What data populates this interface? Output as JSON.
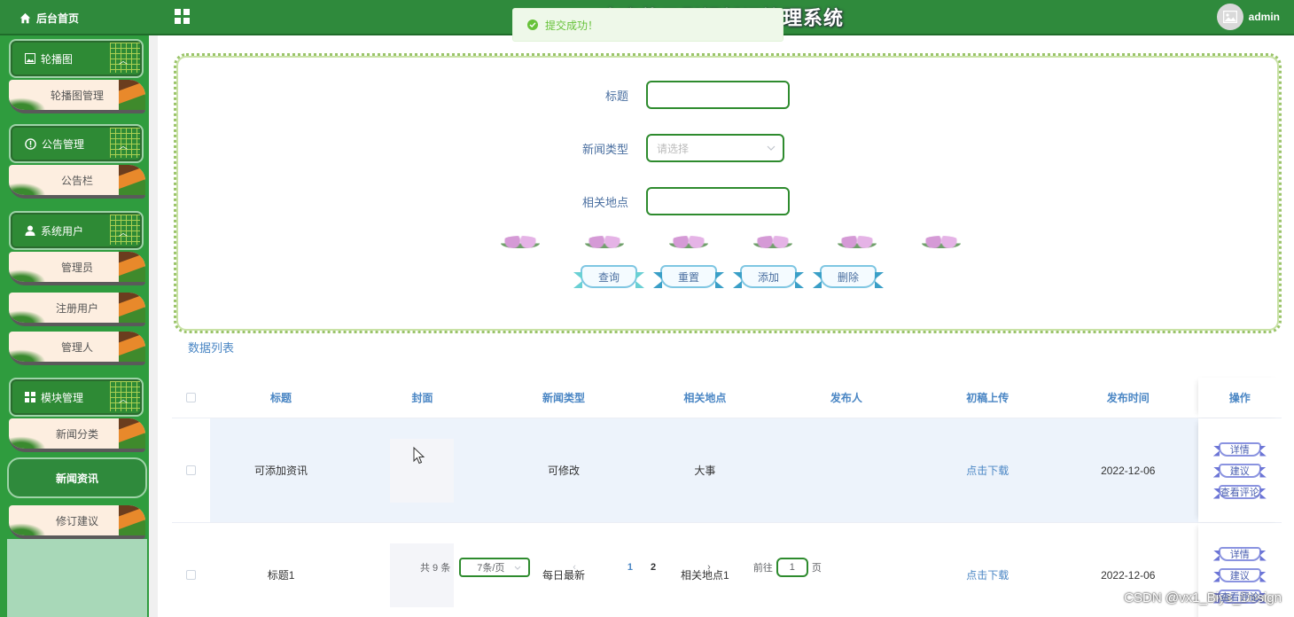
{
  "header": {
    "home_label": "后台首页",
    "title": "欢迎使用影视新闻管理系统",
    "user_name": "admin"
  },
  "toast": {
    "message": "提交成功！",
    "color": "#67c23a"
  },
  "sidebar": {
    "groups": [
      {
        "label": "轮播图",
        "icon": "image-icon",
        "items": [
          "轮播图管理"
        ]
      },
      {
        "label": "公告管理",
        "icon": "info-circle-icon",
        "items": [
          "公告栏"
        ]
      },
      {
        "label": "系统用户",
        "icon": "user-icon",
        "items": [
          "管理员",
          "注册用户",
          "管理人"
        ]
      },
      {
        "label": "模块管理",
        "icon": "grid-icon",
        "items": [
          "新闻分类",
          "新闻资讯",
          "修订建议"
        ]
      }
    ],
    "active_item": "新闻资讯"
  },
  "search": {
    "title_label": "标题",
    "title_value": "",
    "type_label": "新闻类型",
    "type_placeholder": "请选择",
    "location_label": "相关地点",
    "location_value": "",
    "buttons": {
      "query": "查询",
      "reset": "重置",
      "add": "添加",
      "delete": "删除"
    }
  },
  "list_title": "数据列表",
  "table": {
    "headers": [
      "标题",
      "封面",
      "新闻类型",
      "相关地点",
      "发布人",
      "初稿上传",
      "发布时间",
      "操作"
    ],
    "rows": [
      {
        "title": "可添加资讯",
        "type": "可修改",
        "location": "大事",
        "publisher": "",
        "draft": "点击下载",
        "time": "2022-12-06",
        "ops": [
          "详情",
          "建议",
          "查看评论"
        ]
      },
      {
        "title": "标题1",
        "type": "每日最新",
        "location": "相关地点1",
        "publisher": "",
        "draft": "点击下载",
        "time": "2022-12-06",
        "ops": [
          "详情",
          "建议",
          "查看评论"
        ]
      }
    ]
  },
  "pagination": {
    "total_text": "共 9 条",
    "page_size": "7条/页",
    "pages": [
      "1",
      "2"
    ],
    "current_page": "1",
    "goto_prefix": "前往",
    "goto_value": "1",
    "goto_suffix": "页"
  },
  "watermark": "CSDN @vx1_Biye_Design",
  "colors": {
    "primary_green": "#2f8a3c",
    "link_blue": "#4a86c4",
    "highlight_row": "#edf3fb"
  }
}
